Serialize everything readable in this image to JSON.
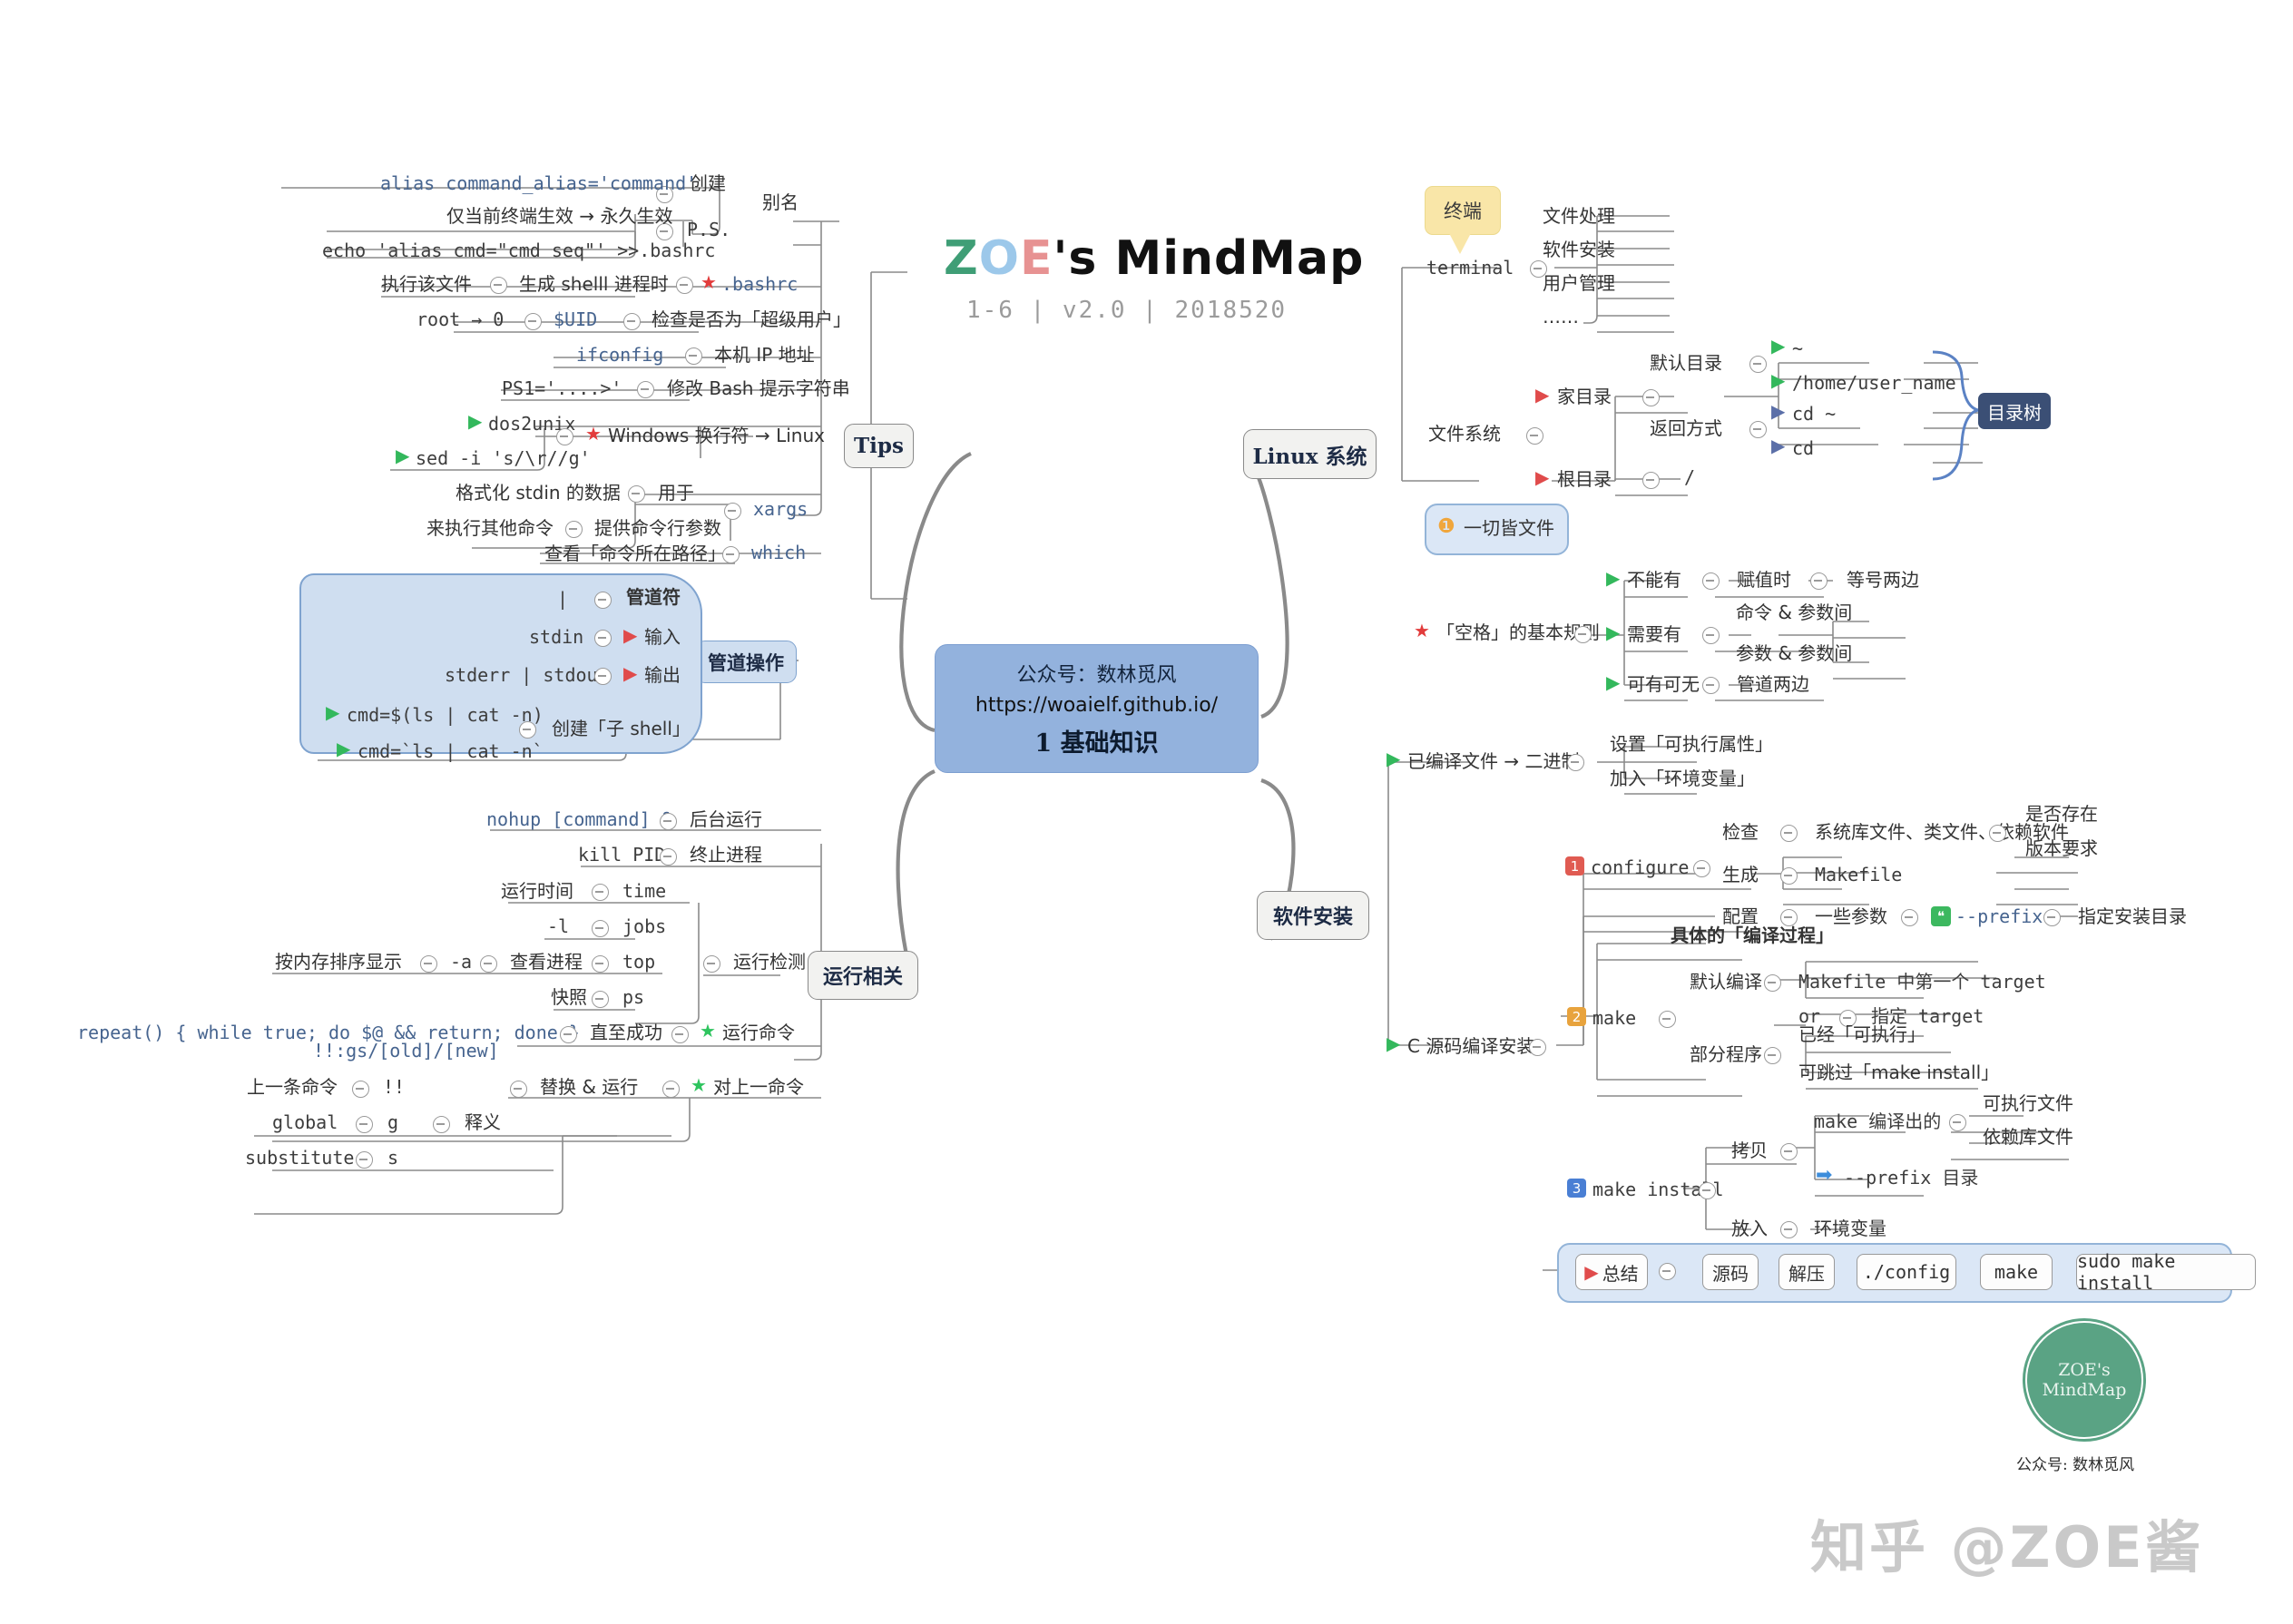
{
  "title": {
    "z": "Z",
    "o": "O",
    "e": "E",
    "rest": "'s MindMap",
    "subtitle": "1-6 | v2.0 | 2018520"
  },
  "central": {
    "line1": "公众号：数林觅风",
    "line2": "https://woaielf.github.io/",
    "line3": "1  基础知识"
  },
  "branches": {
    "tips": "Tips",
    "pipe": "管道操作",
    "runtime": "运行相关",
    "linux": "Linux  系统",
    "software": "软件安装"
  },
  "tips": {
    "alias": {
      "label": "别名",
      "create": "创建",
      "create_cmd": "alias command_alias='command'",
      "ps": "P.S.",
      "ps_a": "仅当前终端生效 → 永久生效",
      "ps_b": "echo 'alias cmd=\"cmd seq\"' >>.bashrc"
    },
    "bashrc": {
      "label": ".bashrc",
      "mid": "生成 shelll 进程时",
      "leaf": "执行该文件"
    },
    "uid": {
      "label": "$UID",
      "mid": "检查是否为「超级用户」",
      "leaf": "root → 0"
    },
    "ifconfig": {
      "label": "ifconfig",
      "mid": "本机 IP 地址"
    },
    "ps1": {
      "label": "PS1='....>'",
      "mid": "修改 Bash 提示字符串"
    },
    "crlf": {
      "label": "Windows 换行符 → Linux",
      "a": "dos2unix",
      "b": "sed -i 's/\\r//g'"
    },
    "xargs": {
      "label": "xargs",
      "m1": "用于",
      "l1": "格式化 stdin 的数据",
      "m2": "提供命令行参数",
      "l2": "来执行其他命令"
    },
    "which": {
      "label": "which",
      "mid": "查看「命令所在路径」"
    }
  },
  "pipe": {
    "pipechar": {
      "label": "管道符",
      "leaf": "|"
    },
    "input": {
      "label": "输入",
      "leaf": "stdin"
    },
    "output": {
      "label": "输出",
      "leaf": "stderr | stdout"
    },
    "subshell": {
      "label": "创建「子 shell」",
      "a": "cmd=$(ls | cat -n)",
      "b": "cmd=`ls | cat -n`"
    }
  },
  "runtime": {
    "bg": {
      "label": "后台运行",
      "cmd": "nohup [command] &"
    },
    "kill": {
      "label": "终止进程",
      "cmd": "kill PID"
    },
    "detect": {
      "label": "运行检测",
      "rows": [
        {
          "r": "time",
          "m": "运行时间"
        },
        {
          "r": "jobs",
          "m": "-l"
        },
        {
          "r": "top",
          "m": "查看进程",
          "l": "按内存排序显示",
          "lm": "-a"
        },
        {
          "r": "ps",
          "m": "快照"
        }
      ]
    },
    "rerun": {
      "label": "运行命令",
      "mid": "直至成功",
      "cmd": "repeat() { while true; do $@ && return; done }"
    },
    "lastcmd": {
      "label": "对上一命令",
      "mid": "替换 & 运行",
      "top": "!!:gs/[old]/[new]",
      "prev_m": "!!",
      "prev_l": "上一条命令",
      "mean": "释义",
      "g_r": "g",
      "g_l": "global",
      "s_r": "s",
      "s_l": "substitute"
    }
  },
  "linux": {
    "terminal": {
      "label": "terminal",
      "tip": "终端",
      "items": [
        "文件处理",
        "软件安装",
        "用户管理",
        "……"
      ]
    },
    "fs": {
      "label": "文件系统",
      "dirtree": "目录树",
      "home": {
        "label": "家目录",
        "def": {
          "label": "默认目录",
          "a": "~",
          "b": "/home/user_name"
        },
        "back": {
          "label": "返回方式",
          "a": "cd ~",
          "b": "cd"
        }
      },
      "root": {
        "label": "根目录",
        "val": "/"
      }
    },
    "everything": "一切皆文件",
    "space": {
      "label": "「空格」的基本规则",
      "no": {
        "label": "不能有",
        "m": "赋值时",
        "r": "等号两边"
      },
      "yes": {
        "label": "需要有",
        "a": "命令 & 参数间",
        "b": "参数 & 参数间"
      },
      "opt": {
        "label": "可有可无",
        "m": "管道两边"
      }
    }
  },
  "software": {
    "compiled": {
      "label": "已编译文件 → 二进制",
      "a": "设置「可执行属性」",
      "b": "加入「环境变量」"
    },
    "csrc": {
      "label": "C 源码编译安装"
    },
    "configure": {
      "num": "1",
      "label": "configure",
      "check": {
        "m": "检查",
        "r": "系统库文件、类文件、依赖软件",
        "a": "是否存在",
        "b": "版本要求"
      },
      "gen": {
        "m": "生成",
        "r": "Makefile"
      },
      "conf": {
        "m": "配置",
        "r": "一些参数",
        "prefix": "--prefix",
        "prefix_desc": "指定安装目录"
      }
    },
    "make": {
      "num": "2",
      "label": "make",
      "top": "具体的「编译过程」",
      "def": {
        "m": "默认编译",
        "a": "Makefile 中第一个 target",
        "b_l": "or",
        "b_r": "指定 target"
      },
      "part": {
        "m": "部分程序",
        "a": "已经「可执行」",
        "b": "可跳过「make install」"
      }
    },
    "makeinstall": {
      "num": "3",
      "label": "make install",
      "copy": {
        "m": "拷贝",
        "from": "make 编译出的",
        "a": "可执行文件",
        "b": "依赖库文件",
        "to": "--prefix 目录"
      },
      "put": {
        "m": "放入",
        "r": "环境变量"
      }
    },
    "summary": {
      "label": "总结",
      "chips": [
        "源码",
        "解压",
        "./config",
        "make",
        "sudo make install"
      ]
    }
  },
  "footer": {
    "stamp_l1": "ZOE's",
    "stamp_l2": "MindMap",
    "caption": "公众号: 数林觅风",
    "watermark": "知乎 @ZOE酱"
  }
}
